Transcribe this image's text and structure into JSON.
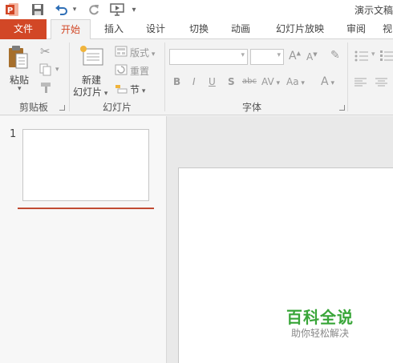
{
  "window": {
    "title": "演示文稿"
  },
  "qat": {
    "customize_label": "▾"
  },
  "tabs": [
    {
      "label": "文件"
    },
    {
      "label": "开始"
    },
    {
      "label": "插入"
    },
    {
      "label": "设计"
    },
    {
      "label": "切换"
    },
    {
      "label": "动画"
    },
    {
      "label": "幻灯片放映"
    },
    {
      "label": "审阅"
    },
    {
      "label": "视"
    }
  ],
  "ribbon": {
    "clipboard": {
      "paste_label": "粘贴",
      "group_label": "剪贴板"
    },
    "slides": {
      "new_slide_line1": "新建",
      "new_slide_line2": "幻灯片",
      "layout_label": "版式",
      "reset_label": "重置",
      "section_label": "节",
      "group_label": "幻灯片"
    },
    "font": {
      "increase_size": "A",
      "decrease_size": "A",
      "bold": "B",
      "italic": "I",
      "underline": "U",
      "shadow": "S",
      "strikethrough": "abc",
      "spacing": "AV",
      "change_case": "Aa",
      "font_color": "A",
      "group_label": "字体"
    }
  },
  "thumbnails": [
    {
      "number": "1"
    }
  ],
  "watermark": {
    "title": "百科全说",
    "subtitle": "助你轻松解决"
  },
  "colors": {
    "accent": "#d24726",
    "watermark": "#3aa63a"
  }
}
